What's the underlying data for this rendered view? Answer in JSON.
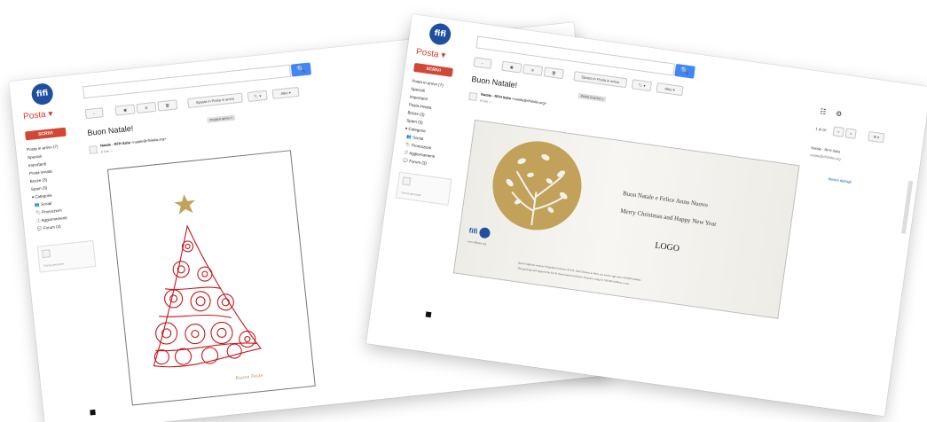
{
  "left_window": {
    "logo_text": "fifi",
    "app_menu": "Posta ▾",
    "search_button": "🔍",
    "compose": "SCRIVI",
    "nav": [
      "Posta in arrivo (7)",
      "Speciali",
      "Importanti",
      "Posta inviata",
      "Bozze (3)",
      "Spam (3)"
    ],
    "categories_label": "▾ Categorie",
    "categories": [
      "Social",
      "Promozioni",
      "Aggiornamenti",
      "Forum (3)"
    ],
    "toolbar": {
      "back": "←",
      "archive": "▣",
      "report": "⊘",
      "delete": "🗑",
      "move": "Sposta in Posta in arrivo",
      "labels": "🏷 ▾",
      "more": "Altro ▾"
    },
    "subject": "Buon Natale!",
    "label_tag": "Posta in arrivo ×",
    "sender": "Natale - RFH Italia",
    "sender_email": "<natale@rfhitalia.org>",
    "date": "8 Feb ☆",
    "chat_search": "Cerca persone",
    "card_signature": "Buone Feste"
  },
  "right_window": {
    "logo_text": "fifi",
    "app_menu": "Posta ▾",
    "search_button": "🔍",
    "compose": "SCRIVI",
    "nav": [
      "Posta in arrivo (7)",
      "Speciali",
      "Importanti",
      "Posta inviata",
      "Bozze (3)",
      "Spam (3)"
    ],
    "categories_label": "▾ Categorie",
    "categories": [
      "Social",
      "Promozioni",
      "Aggiornamenti",
      "Forum (3)"
    ],
    "toolbar": {
      "back": "←",
      "archive": "▣",
      "report": "⊘",
      "delete": "🗑",
      "move": "Sposta in Posta in arrivo",
      "labels": "🏷 ▾",
      "more": "Altro ▾"
    },
    "subject": "Buon Natale!",
    "label_tag": "Posta in arrivo ×",
    "sender": "Natale - RFH Italia",
    "sender_email": "<natale@rfhitalia.org>",
    "date": "8 Feb ☆",
    "pager": "1 di 10",
    "pager_prev": "<",
    "pager_next": ">",
    "settings": "⚙ ▾",
    "contact_name": "Natale - RFH Italia",
    "contact_email": "natale@rfhitalia.org",
    "contact_link": "Mostra dettagli",
    "chat_search": "Cerca persone",
    "card": {
      "greeting_it": "Buon Natale e Felice Anno Nuovo",
      "greeting_en": "Merry Christmas and Happy New Year",
      "logo": "LOGO",
      "org_logo_text": "fifi",
      "org_site": "www.rfhitalia.org",
      "fine_print_1": "Questo biglietto sostiene l'Ospedale Pediatrico R.F.H. Saint Damien in Haiti, che assiste ogni anno 100.000 bambini.",
      "fine_print_2": "This greeting card supports the R.F.H. Saint Damien Pediatric Hospital caring for 100.000 children a year."
    }
  },
  "colors": {
    "gmail_red": "#d14836",
    "search_blue": "#4285f4",
    "tree_red": "#c4161c",
    "gold": "#c2a25a",
    "logo_blue": "#1f4f9e"
  }
}
